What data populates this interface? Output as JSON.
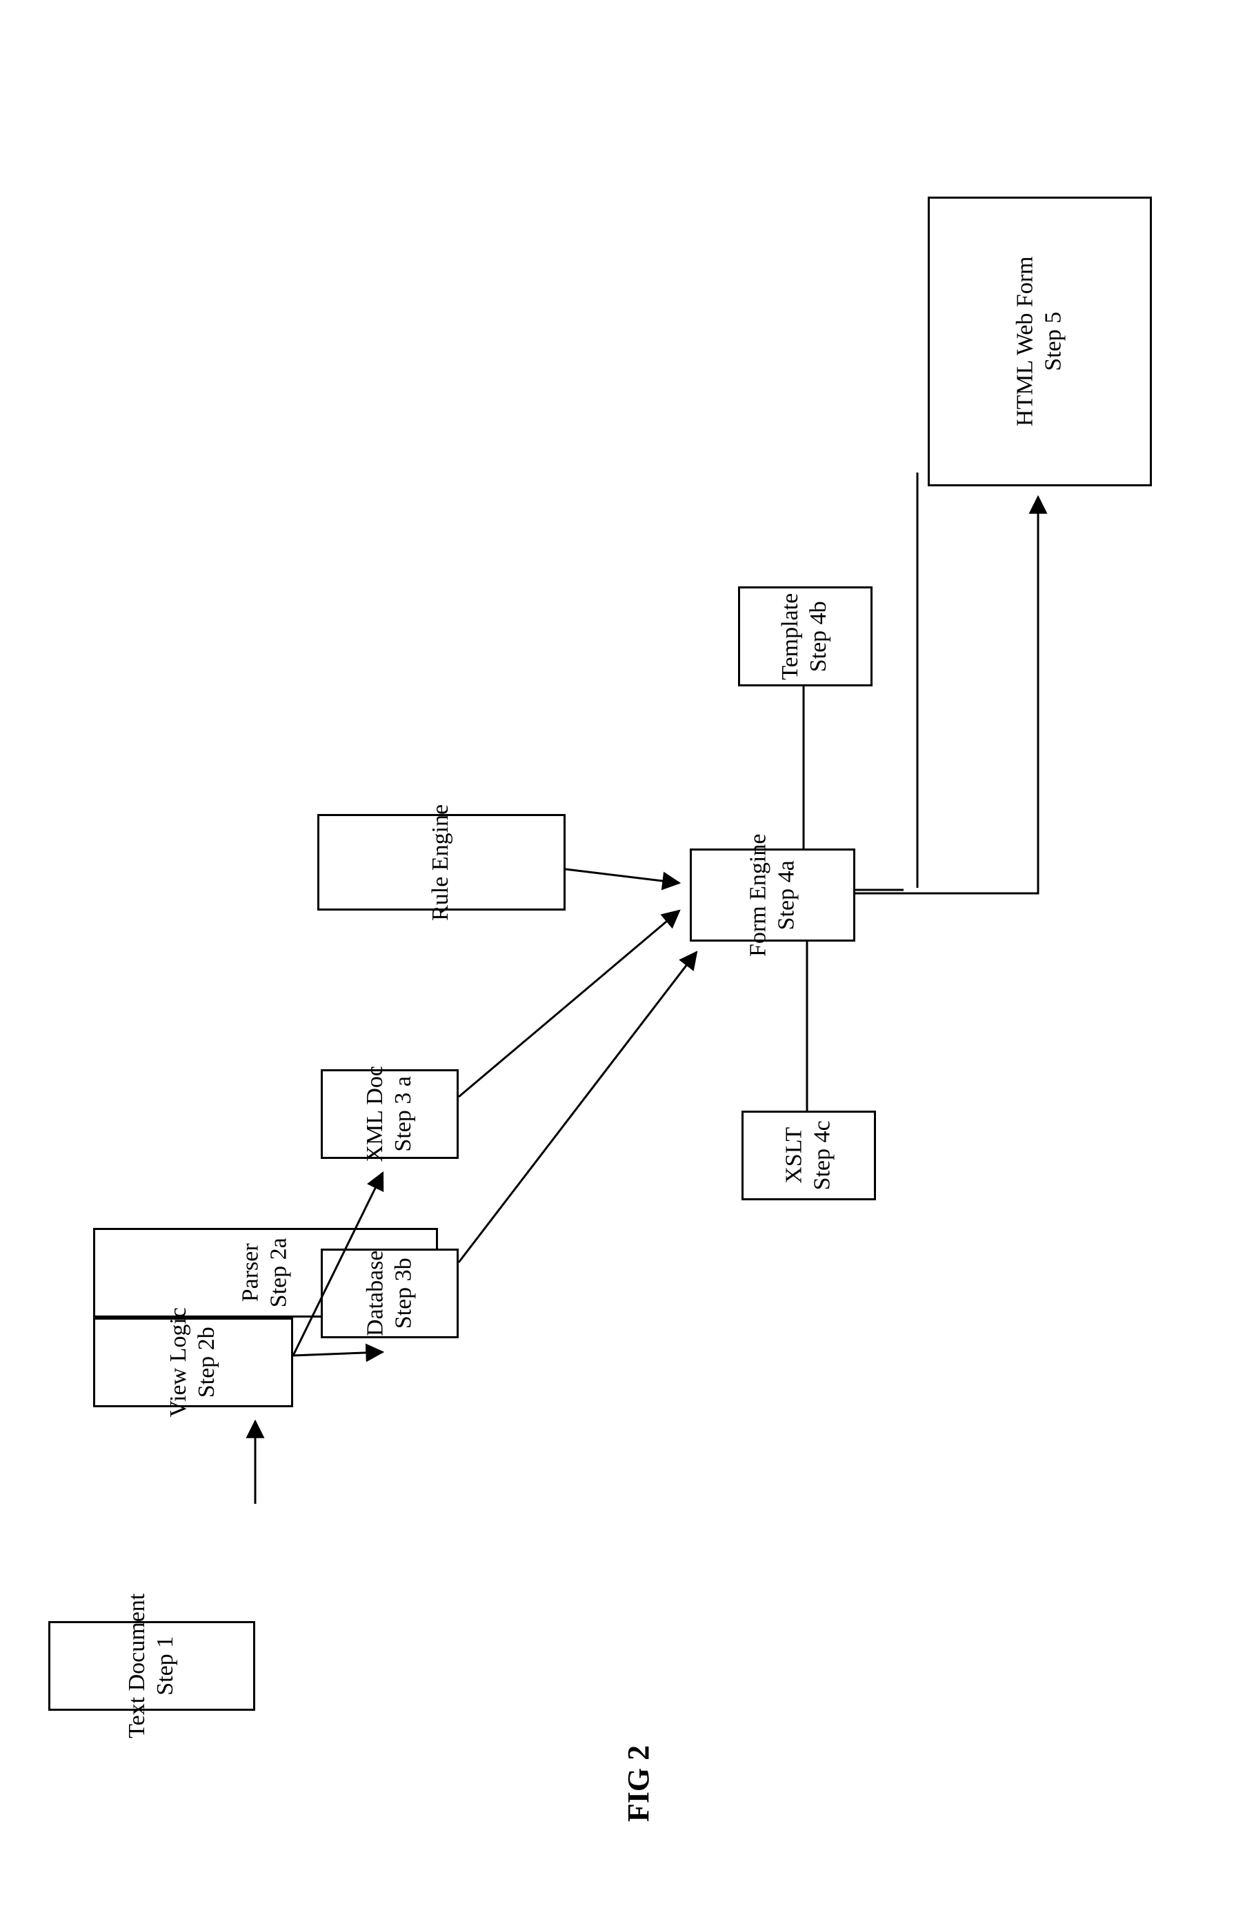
{
  "figure_label": "FIG 2",
  "nodes": {
    "text_document": {
      "line1": "Text Document",
      "line2": "Step 1"
    },
    "parser": {
      "line1": "Parser",
      "line2": "Step 2a"
    },
    "view_logic": {
      "line1": "View Logic",
      "line2": "Step 2b"
    },
    "rule_engine": {
      "line1": "Rule Engine",
      "line2": ""
    },
    "xml_doc": {
      "line1": "XML Doc",
      "line2": "Step 3 a"
    },
    "database": {
      "line1": "Database",
      "line2": "Step 3b"
    },
    "template": {
      "line1": "Template",
      "line2": "Step 4b"
    },
    "form_engine": {
      "line1": "Form Engine",
      "line2": "Step 4a"
    },
    "xslt": {
      "line1": "XSLT",
      "line2": "Step 4c"
    },
    "html_web_form": {
      "line1": "HTML Web Form",
      "line2": "Step 5"
    }
  },
  "edges": [
    {
      "from": "text_document",
      "to": "parser"
    },
    {
      "from": "view_logic",
      "to": "xml_doc"
    },
    {
      "from": "view_logic",
      "to": "database"
    },
    {
      "from": "rule_engine",
      "to": "form_engine"
    },
    {
      "from": "xml_doc",
      "to": "form_engine"
    },
    {
      "from": "database",
      "to": "form_engine"
    },
    {
      "from": "template",
      "to": "form_engine",
      "undirected": true
    },
    {
      "from": "xslt",
      "to": "form_engine",
      "undirected": true
    },
    {
      "from": "form_engine",
      "to": "html_web_form"
    }
  ]
}
